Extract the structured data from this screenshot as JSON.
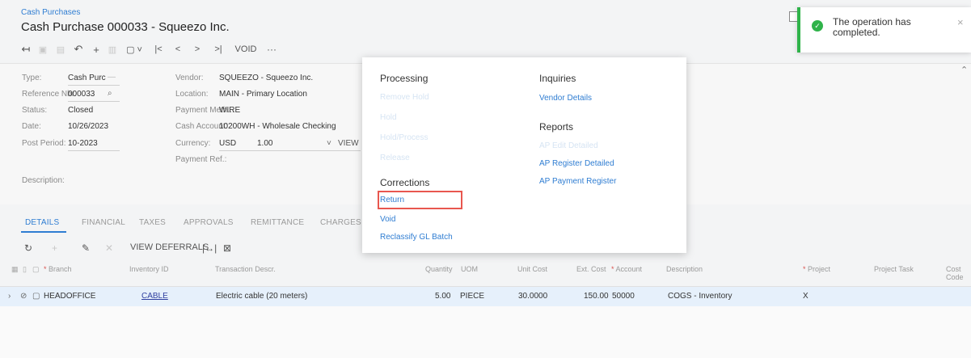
{
  "header": {
    "breadcrumb": "Cash Purchases",
    "title": "Cash Purchase 000033 - Squeezo Inc."
  },
  "toolbar": {
    "icons": [
      "back-arrow",
      "save",
      "copy",
      "undo",
      "add",
      "delete",
      "copy-paste",
      "first",
      "previous",
      "next",
      "last"
    ],
    "glyph_back": "↤",
    "glyph_undo": "↶",
    "glyph_add": "+",
    "glyph_copy": "▢ ˅",
    "glyph_first": "|<",
    "glyph_prev": "<",
    "glyph_next": ">",
    "glyph_last": ">|",
    "void_label": "VOID",
    "more_label": "···"
  },
  "form": {
    "type_label": "Type:",
    "type_value": "Cash Purc",
    "refnbr_label": "Reference Nbr.",
    "refnbr_value": "000033",
    "status_label": "Status:",
    "status_value": "Closed",
    "date_label": "Date:",
    "date_value": "10/26/2023",
    "period_label": "Post Period:",
    "period_value": "10-2023",
    "description_label": "Description:",
    "vendor_label": "Vendor:",
    "vendor_value": "SQUEEZO - Squeezo Inc.",
    "location_label": "Location:",
    "location_value": "MAIN - Primary Location",
    "paymethod_label": "Payment Meth...",
    "paymethod_value": "WIRE",
    "cashacct_label": "Cash Account:",
    "cashacct_value": "10200WH - Wholesale Checking",
    "currency_label": "Currency:",
    "currency_value": "USD",
    "currency_rate": "1.00",
    "currency_view": "VIEW",
    "payref_label": "Payment Ref.:"
  },
  "tabs": [
    "DETAILS",
    "FINANCIAL",
    "TAXES",
    "APPROVALS",
    "REMITTANCE",
    "CHARGES"
  ],
  "grid_toolbar": {
    "view_deferrals": "VIEW DEFERRALS"
  },
  "grid": {
    "columns": {
      "branch": "Branch",
      "inventory": "Inventory ID",
      "trandesc": "Transaction Descr.",
      "quantity": "Quantity",
      "uom": "UOM",
      "unitcost": "Unit Cost",
      "extcost": "Ext. Cost",
      "account": "Account",
      "description": "Description",
      "project": "Project",
      "projecttask": "Project Task",
      "costcode_1": "Cost",
      "costcode_2": "Code"
    },
    "row": {
      "branch": "HEADOFFICE",
      "inventory": "CABLE",
      "trandesc": "Electric cable (20 meters)",
      "quantity": "5.00",
      "uom": "PIECE",
      "unitcost": "30.0000",
      "extcost": "150.00",
      "account": "50000",
      "description": "COGS - Inventory",
      "project": "X"
    }
  },
  "menu": {
    "processing_title": "Processing",
    "processing_items": [
      "Remove Hold",
      "Hold",
      "Hold/Process",
      "Release"
    ],
    "corrections_title": "Corrections",
    "corrections_items": [
      "Return",
      "Void",
      "Reclassify GL Batch"
    ],
    "inquiries_title": "Inquiries",
    "inquiries_items": [
      "Vendor Details"
    ],
    "reports_title": "Reports",
    "reports_items": [
      "AP Edit Detailed",
      "AP Register Detailed",
      "AP Payment Register"
    ]
  },
  "toast": {
    "message": "The operation has completed.",
    "close": "×"
  },
  "colors": {
    "accent": "#2f7dd2",
    "success": "#2fb34a",
    "highlight": "#e8574f"
  }
}
